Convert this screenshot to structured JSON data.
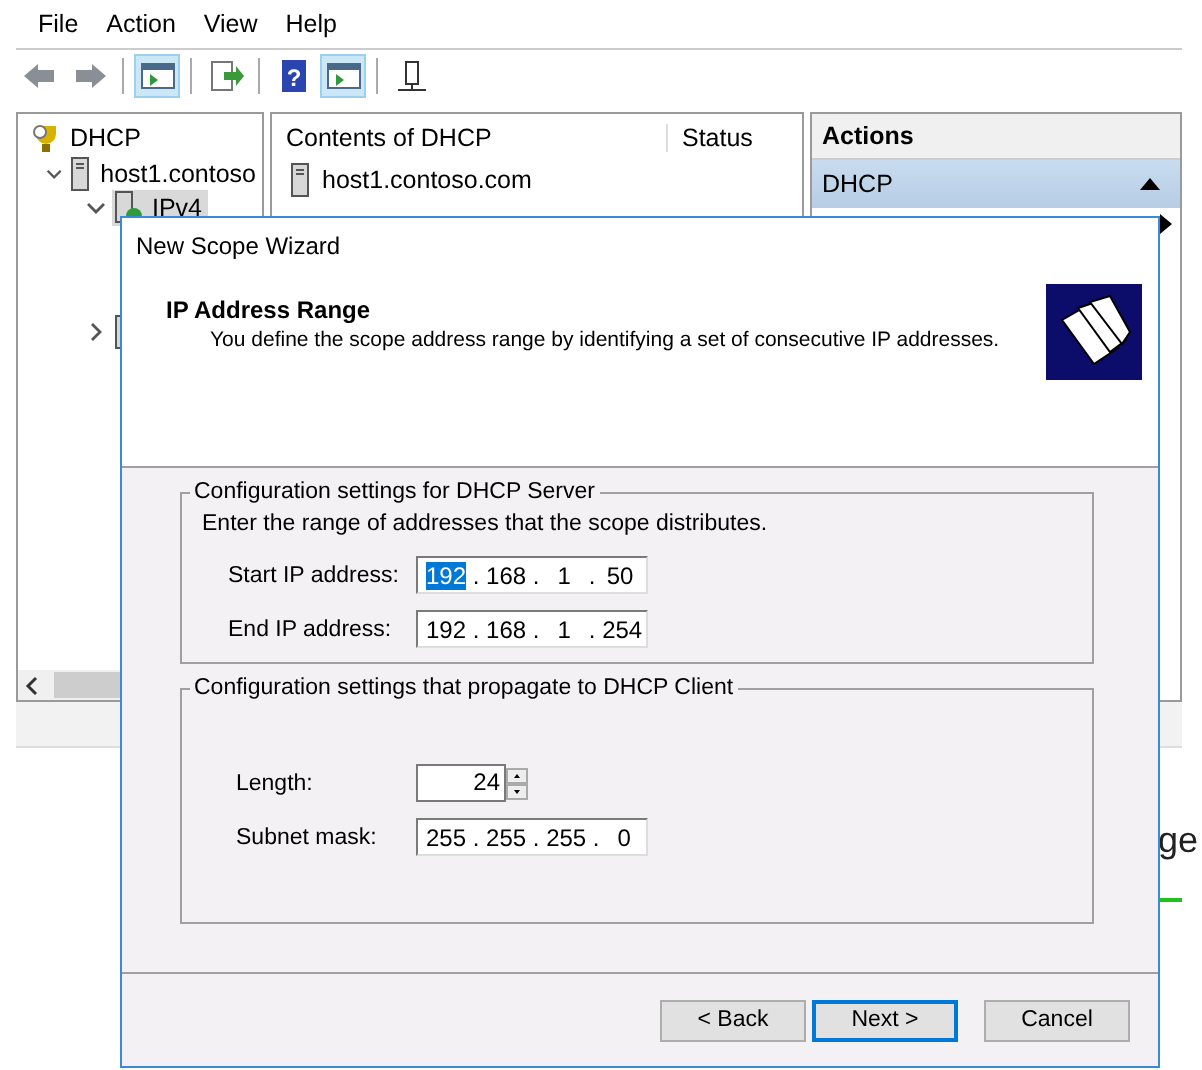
{
  "menu": [
    "File",
    "Action",
    "View",
    "Help"
  ],
  "toolbar": [
    {
      "kind": "back",
      "selected": false
    },
    {
      "kind": "forward",
      "selected": false
    },
    {
      "kind": "tree",
      "selected": true
    },
    {
      "kind": "export",
      "selected": false
    },
    {
      "kind": "help",
      "label": "?",
      "selected": false
    },
    {
      "kind": "pane",
      "selected": true
    },
    {
      "kind": "server",
      "selected": false
    }
  ],
  "tree": [
    {
      "label": "DHCP",
      "selected": false,
      "children": [
        {
          "label": "host1.contoso",
          "expanded": true,
          "selected": false,
          "children": [
            {
              "label": "IPv4",
              "expanded": true,
              "selected": true
            },
            {
              "expanded": false,
              "selected": false
            }
          ]
        }
      ]
    }
  ],
  "contents": {
    "columns": [
      "Contents of DHCP",
      "Status"
    ],
    "rows": [
      {
        "name": "host1.contoso.com"
      }
    ]
  },
  "actions": {
    "title": "Actions",
    "section": "DHCP"
  },
  "background_text": "ge",
  "wizard": {
    "title": "New Scope Wizard",
    "heading": "IP Address Range",
    "description": "You define the scope address range by identifying a set of consecutive IP addresses.",
    "octet_separator": ".",
    "groups": [
      {
        "legend": "Configuration settings for DHCP Server",
        "note": "Enter the range of addresses that the scope distributes.",
        "fields": [
          {
            "kind": "ip",
            "label": "Start IP address:",
            "octets": [
              {
                "value": "192",
                "selected": true
              },
              {
                "value": "168",
                "selected": false
              },
              {
                "value": "1",
                "selected": false
              },
              {
                "value": "50",
                "selected": false
              }
            ]
          },
          {
            "kind": "ip",
            "label": "End IP address:",
            "octets": [
              {
                "value": "192",
                "selected": false
              },
              {
                "value": "168",
                "selected": false
              },
              {
                "value": "1",
                "selected": false
              },
              {
                "value": "254",
                "selected": false
              }
            ]
          }
        ]
      },
      {
        "legend": "Configuration settings that propagate to DHCP Client",
        "fields": [
          {
            "kind": "spin",
            "label": "Length:",
            "value": "24"
          },
          {
            "kind": "ip",
            "label": "Subnet mask:",
            "octets": [
              {
                "value": "255",
                "selected": false
              },
              {
                "value": "255",
                "selected": false
              },
              {
                "value": "255",
                "selected": false
              },
              {
                "value": "0",
                "selected": false
              }
            ]
          }
        ]
      }
    ],
    "buttons": [
      {
        "label": "< Back",
        "default": false
      },
      {
        "label": "Next >",
        "default": true
      },
      {
        "label": "Cancel",
        "default": false
      }
    ]
  }
}
